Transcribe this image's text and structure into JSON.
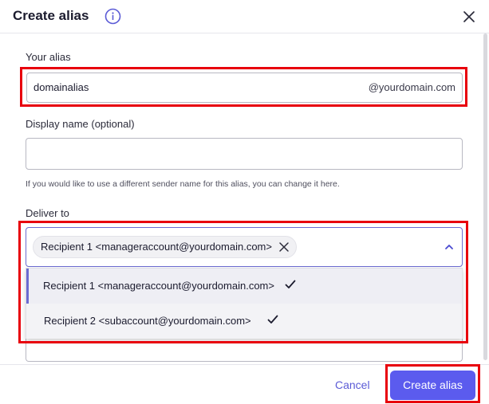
{
  "dialog": {
    "title": "Create alias",
    "icons": {
      "info": "info-circle-icon",
      "close": "close-x-icon"
    }
  },
  "alias": {
    "label": "Your alias",
    "value": "domainalias",
    "suffix": "@yourdomain.com"
  },
  "display_name": {
    "label": "Display name (optional)",
    "value": "",
    "hint": "If you would like to use a different sender name for this alias, you can change it here."
  },
  "deliver_to": {
    "label": "Deliver to",
    "selected_chip": "Recipient 1 <manageraccount@yourdomain.com>",
    "options": [
      {
        "label": "Recipient 1 <manageraccount@yourdomain.com>",
        "checked": true
      },
      {
        "label": "Recipient 2 <subaccount@yourdomain.com>",
        "checked": true
      }
    ]
  },
  "footer": {
    "cancel_label": "Cancel",
    "create_label": "Create alias"
  },
  "colors": {
    "accent": "#5b5bee",
    "highlight": "#e8000c",
    "link": "#5b5bd6"
  }
}
